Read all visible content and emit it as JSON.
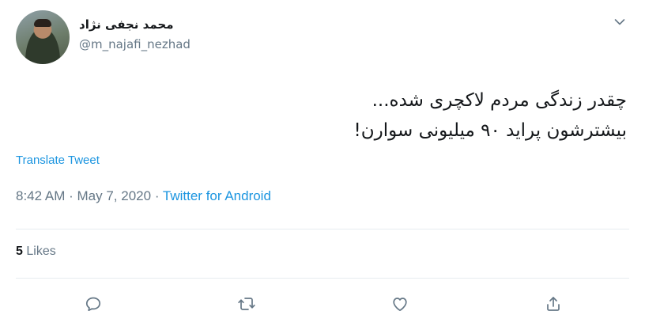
{
  "user": {
    "display_name": "محمد نجفی نژاد",
    "handle": "@m_najafi_nezhad"
  },
  "tweet": {
    "lines": [
      "چقدر زندگی مردم لاکچری شده...",
      "بیشترشون پراید ۹۰ میلیونی سوارن!"
    ],
    "translate_label": "Translate Tweet",
    "time": "8:42 AM",
    "sep1": "·",
    "date": "May 7, 2020",
    "sep2": "·",
    "source": "Twitter for Android"
  },
  "stats": {
    "likes_count": "5",
    "likes_label": "Likes"
  },
  "icons": {
    "caret": "chevron-down-icon",
    "reply": "reply-icon",
    "retweet": "retweet-icon",
    "like": "heart-icon",
    "share": "share-icon"
  },
  "colors": {
    "link": "#1b95e0",
    "muted": "#657786",
    "text": "#14171a",
    "divider": "#e6ecf0"
  }
}
